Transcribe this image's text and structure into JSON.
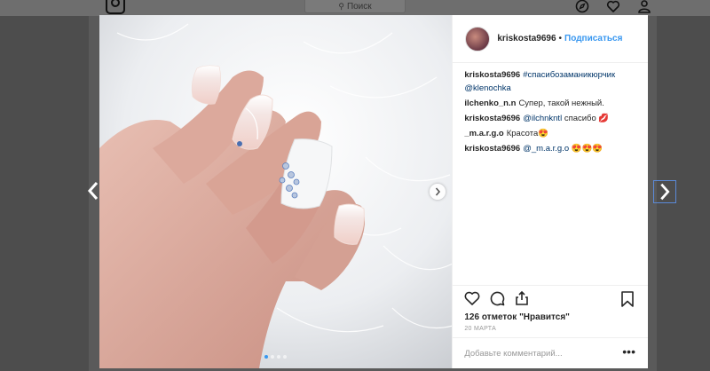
{
  "header": {
    "search_placeholder": "Поиск",
    "icons": [
      "instagram-logo-icon",
      "compass-icon",
      "heart-icon",
      "profile-icon"
    ]
  },
  "post": {
    "author": "kriskosta9696",
    "separator": "•",
    "follow_label": "Подписаться",
    "caption": {
      "user": "kriskosta9696",
      "hashtag": "#спасибозаманикюрчик",
      "mention": "@klenochka"
    },
    "comments": [
      {
        "user": "ilchenko_n.n",
        "text": "Супер, такой нежный."
      },
      {
        "user": "kriskosta9696",
        "mention": "@ilchnkntl",
        "text": " спасибо 💋"
      },
      {
        "user": "_m.a.r.g.o",
        "text": "Красота😍"
      },
      {
        "user": "kriskosta9696",
        "mention": "@_m.a.r.g.o",
        "text": " 😍😍😍"
      }
    ],
    "likes": "126 отметок \"Нравится\"",
    "date": "20 МАРТА",
    "comment_placeholder": "Добавьте комментарий...",
    "more_label": "•••",
    "carousel_count": 4,
    "carousel_active": 1
  },
  "colors": {
    "link": "#003569",
    "accent": "#3897f0"
  }
}
